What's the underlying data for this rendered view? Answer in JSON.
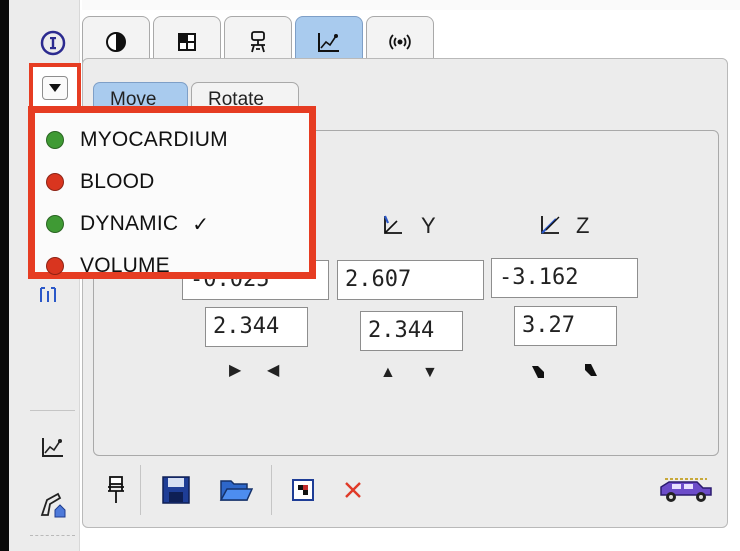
{
  "colors": {
    "highlight_red": "#e63c22",
    "active_tab_blue": "#a9cbee",
    "dot_green": "#3f9a34",
    "dot_red": "#d9351f"
  },
  "tabs": [
    {
      "icon": "half-circle-icon",
      "active": false
    },
    {
      "icon": "grid-icon",
      "active": false
    },
    {
      "icon": "robot-icon",
      "active": false
    },
    {
      "icon": "chart-line-icon",
      "active": true
    },
    {
      "icon": "signal-icon",
      "active": false
    }
  ],
  "subtabs": {
    "move_label": "Move",
    "rotate_label": "Rotate"
  },
  "menu": {
    "items": [
      {
        "label": "MYOCARDIUM",
        "dot": "green",
        "checked": false
      },
      {
        "label": "BLOOD",
        "dot": "red",
        "checked": false
      },
      {
        "label": "DYNAMIC",
        "dot": "green",
        "checked": true
      },
      {
        "label": "VOLUME",
        "dot": "red",
        "checked": false
      }
    ],
    "check_mark": "✓"
  },
  "axes": {
    "x": {
      "position": "-0.025",
      "step": "2.344"
    },
    "y": {
      "label": "Y",
      "position": "2.607",
      "step": "2.344"
    },
    "z": {
      "label": "Z",
      "position": "-3.162",
      "step": "3.27"
    }
  }
}
